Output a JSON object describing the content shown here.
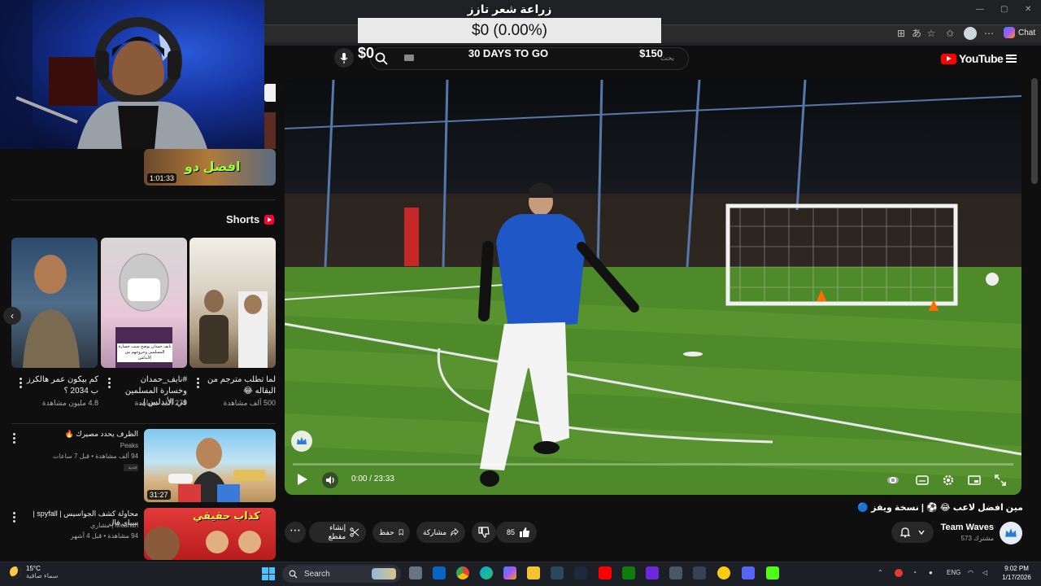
{
  "overlay": {
    "title": "زراعة شعر تازز",
    "progress_text": "$0 (0.00%)",
    "current_amount": "$0",
    "days_to_go": "30 DAYS TO GO",
    "goal_amount": "$150"
  },
  "browser": {
    "chat_label": "Chat"
  },
  "header": {
    "logo_text": "YouTube",
    "logo_region": "SA",
    "search_placeholder": "بحث"
  },
  "sidebar_top": {
    "video_duration": "1:01:33",
    "thumb_caption": "افضل دو"
  },
  "shorts": {
    "header": "Shorts",
    "items": [
      {
        "title": "لما تطلب مترجم من البقاله 😂",
        "views": "500 ألف مشاهدة"
      },
      {
        "title": "#نايف_حمدان وخسارة المسلمين في الأندلس |...",
        "views": "279 ألف مشاهدة",
        "caption": "نايف حمدان يوضح سبب خسارة المسلمين وخروجهم من الأندلس"
      },
      {
        "title": "كم بيكون عمر هالكرز ب 2034 ؟",
        "views": "4.8 مليون مشاهدة"
      }
    ]
  },
  "related": [
    {
      "title": "الظرف يحدد مصيرك 🔥",
      "channel": "Peaks",
      "meta": "94 ألف مشاهدة • قبل 7 ساعات",
      "badge": "جديد",
      "duration": "31:27"
    },
    {
      "title": "محاولة كشف الجواسيس | spyfall | سباي فال",
      "channel": "Meshari | مشاري",
      "meta": "94 مشاهدة • قبل 4 أشهر",
      "thumb_caption": "كذاب حقيقي"
    }
  ],
  "player": {
    "time": "0:00 / 23:33",
    "progress": 0.0
  },
  "video": {
    "title": "مين افضل لاعب 😂 ⚽ | نسخة ويفز 🔵",
    "channel": "Team Waves",
    "subscribers": "573 مشترك",
    "likes": "85",
    "share_label": "مشاركة",
    "save_label": "حفظ",
    "clip_label": "إنشاء مقطع"
  },
  "taskbar": {
    "temperature": "15°C",
    "weather": "سماء صافية",
    "search_label": "Search",
    "lang": "ENG",
    "time": "9:02 PM",
    "date": "1/17/2026"
  },
  "colors": {
    "accent": "#ff0000",
    "background": "#0f0f0f",
    "pill": "#272727"
  }
}
